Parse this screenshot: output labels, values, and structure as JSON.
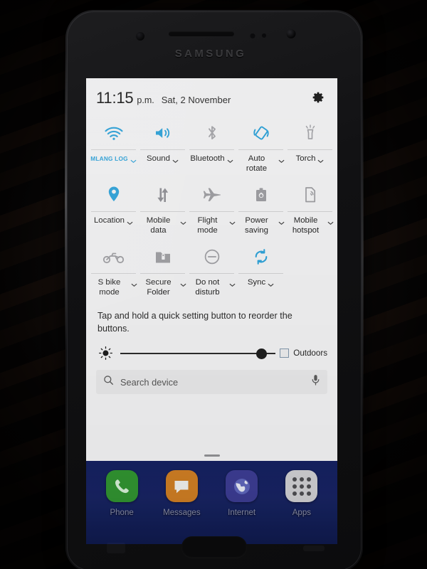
{
  "device": {
    "brand": "SAMSUNG"
  },
  "status_bar": {
    "time": "11:15",
    "ampm": "p.m.",
    "date": "Sat, 2 November",
    "settings_icon": "gear-icon"
  },
  "quick_settings": {
    "tip": "Tap and hold a quick setting button to reorder the buttons.",
    "rows": [
      [
        {
          "label": "MLANG LOG",
          "icon": "wifi-icon",
          "state": "on",
          "has_caret": true,
          "is_wifi_ssid": true
        },
        {
          "label": "Sound",
          "icon": "sound-icon",
          "state": "on",
          "has_caret": true
        },
        {
          "label": "Bluetooth",
          "icon": "bluetooth-icon",
          "state": "off",
          "has_caret": true
        },
        {
          "label": "Auto rotate",
          "icon": "auto-rotate-icon",
          "state": "on",
          "has_caret": true
        },
        {
          "label": "Torch",
          "icon": "torch-icon",
          "state": "off",
          "has_caret": true
        }
      ],
      [
        {
          "label": "Location",
          "icon": "location-pin-icon",
          "state": "on",
          "has_caret": true
        },
        {
          "label": "Mobile data",
          "icon": "mobile-data-icon",
          "state": "off",
          "has_caret": true
        },
        {
          "label": "Flight mode",
          "icon": "airplane-icon",
          "state": "off",
          "has_caret": true
        },
        {
          "label": "Power saving",
          "icon": "power-saving-icon",
          "state": "off",
          "has_caret": true
        },
        {
          "label": "Mobile hotspot",
          "icon": "hotspot-icon",
          "state": "off",
          "has_caret": true
        }
      ],
      [
        {
          "label": "S bike mode",
          "icon": "motorcycle-icon",
          "state": "off",
          "has_caret": true
        },
        {
          "label": "Secure Folder",
          "icon": "secure-folder-icon",
          "state": "off",
          "has_caret": true
        },
        {
          "label": "Do not disturb",
          "icon": "do-not-disturb-icon",
          "state": "off",
          "has_caret": true
        },
        {
          "label": "Sync",
          "icon": "sync-icon",
          "state": "on",
          "has_caret": true
        },
        {
          "label": "",
          "icon": "",
          "state": "empty",
          "has_caret": false
        }
      ]
    ]
  },
  "brightness": {
    "icon": "brightness-icon",
    "value_percent": 93,
    "outdoors_label": "Outdoors",
    "outdoors_checked": false
  },
  "search": {
    "placeholder": "Search device",
    "value": "",
    "search_icon": "search-icon",
    "mic_icon": "microphone-icon"
  },
  "dock": {
    "apps": [
      {
        "label": "Phone",
        "icon": "phone-handset-icon",
        "color": "#2f8f2f"
      },
      {
        "label": "Messages",
        "icon": "message-bubble-icon",
        "color": "#c97a22"
      },
      {
        "label": "Internet",
        "icon": "globe-icon",
        "color": "#3a3a8e"
      },
      {
        "label": "Apps",
        "icon": "apps-grid-icon",
        "color": "#c9c9cc"
      }
    ]
  },
  "colors": {
    "accent_on": "#2e9fd4",
    "icon_off": "#9a9a9e",
    "panel_bg": "#ececed",
    "dock_bg": "#16225f"
  }
}
